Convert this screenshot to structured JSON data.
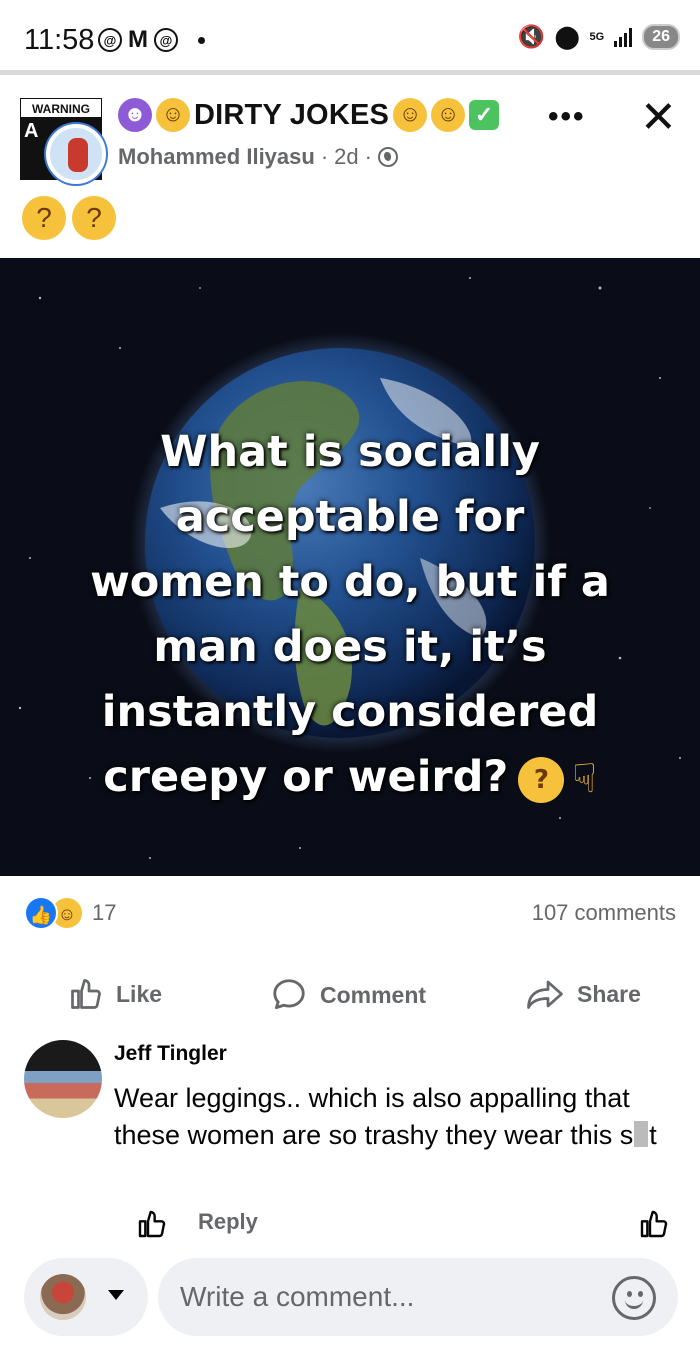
{
  "status_bar": {
    "time": "11:58",
    "network": "5G",
    "battery": "26"
  },
  "post": {
    "group_name": "DIRTY JOKES",
    "author": "Mohammed Iliyasu",
    "age": "2d",
    "group_pic_text": "WARNING",
    "image_text_lines": [
      "What is socially",
      "acceptable for",
      "women to do, but if a",
      "man does it, it’s",
      "instantly considered",
      "creepy or weird?"
    ],
    "reactions_count": "17",
    "comments_count": "107 comments",
    "colors": {
      "accent": "#1877f2",
      "secondary_text": "#65676b",
      "composer_bg": "#eef0f3"
    }
  },
  "actions": {
    "like": "Like",
    "comment": "Comment",
    "share": "Share"
  },
  "comment": {
    "author": "Jeff Tingler",
    "text_part1": "Wear leggings.. which is also appalling that these women are so trashy they wear this s",
    "text_part2": "t",
    "reply": "Reply"
  },
  "composer": {
    "placeholder": "Write a comment..."
  },
  "icons": [
    "devil-emoji",
    "laughing-emoji",
    "check-emoji",
    "thinking-emoji",
    "pointing-down-emoji",
    "globe-icon",
    "more-icon",
    "close-icon",
    "like-icon",
    "comment-icon",
    "share-icon",
    "smiley-icon"
  ]
}
